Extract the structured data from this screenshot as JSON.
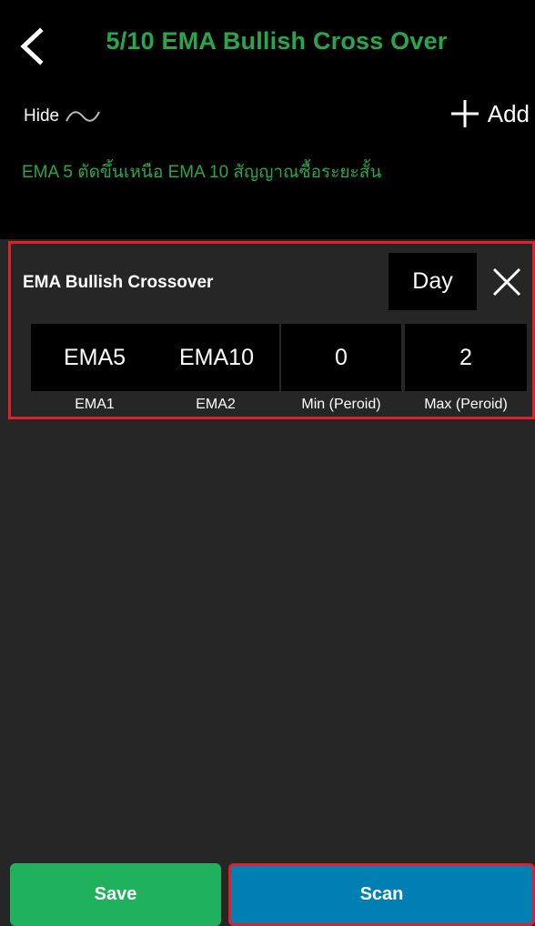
{
  "header": {
    "title": "5/10 EMA Bullish Cross Over",
    "hide_label": "Hide",
    "add_label": "Add",
    "description": "EMA 5 ตัดขึ้นเหนือ EMA 10 สัญญาณซื้อระยะสั้น"
  },
  "condition": {
    "title": "EMA Bullish Crossover",
    "period": "Day",
    "values": [
      "EMA5",
      "EMA10",
      "0",
      "2"
    ],
    "labels": [
      "EMA1",
      "EMA2",
      "Min (Peroid)",
      "Max (Peroid)"
    ]
  },
  "footer": {
    "save_label": "Save",
    "scan_label": "Scan"
  },
  "colors": {
    "accent_green": "#2aa64a",
    "save_green": "#20b15d",
    "scan_blue": "#0080b2",
    "highlight_red": "#e0202a"
  }
}
